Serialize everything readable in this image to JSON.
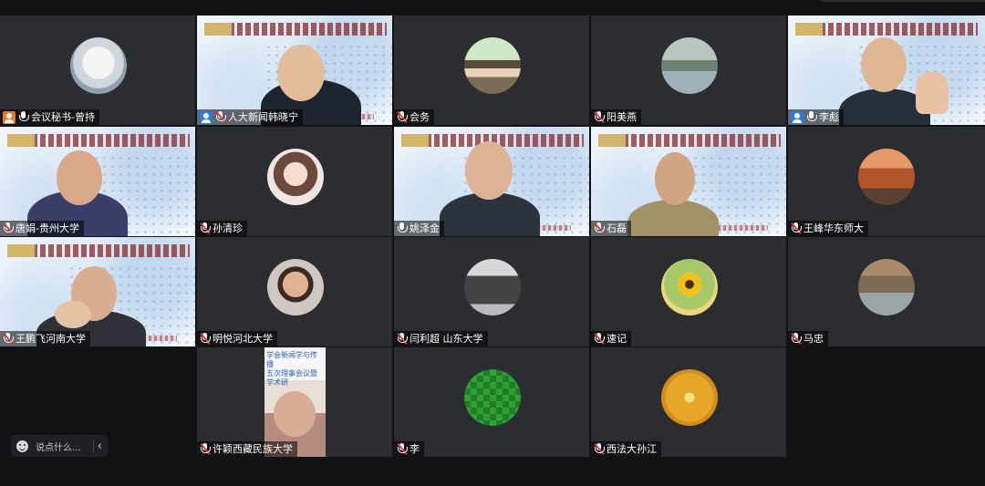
{
  "colors": {
    "background": "#111214",
    "tile": "#2b2d31",
    "active_speaker": "#29c04f",
    "host_badge": "#e8772a",
    "cohost_badge": "#2d7be0",
    "muted": "#e23a3a"
  },
  "participants": [
    {
      "name": "会议秘书-曾持",
      "badge": "host",
      "mic": "on",
      "view": "avatar",
      "avatar": "polar-bear-avatar"
    },
    {
      "name": "人大新闻韩晓宁",
      "badge": "cohost",
      "mic": "muted",
      "view": "video"
    },
    {
      "name": "会务",
      "badge": "",
      "mic": "muted",
      "view": "avatar",
      "avatar": "anime-avatar"
    },
    {
      "name": "阳美燕",
      "badge": "",
      "mic": "muted",
      "view": "avatar",
      "avatar": "lake-painting-avatar"
    },
    {
      "name": "李彪",
      "badge": "cohost",
      "mic": "on-green",
      "view": "video",
      "active": true
    },
    {
      "name": "唐娟-贵州大学",
      "badge": "",
      "mic": "muted",
      "view": "video"
    },
    {
      "name": "孙清珍",
      "badge": "",
      "mic": "muted",
      "view": "avatar",
      "avatar": "girl-portrait-avatar"
    },
    {
      "name": "姚泽金",
      "badge": "",
      "mic": "on",
      "view": "video"
    },
    {
      "name": "石磊",
      "badge": "",
      "mic": "muted",
      "view": "video"
    },
    {
      "name": "王峰华东师大",
      "badge": "",
      "mic": "muted",
      "view": "avatar",
      "avatar": "building-avatar"
    },
    {
      "name": "王鹏飞河南大学",
      "badge": "",
      "mic": "muted",
      "view": "video"
    },
    {
      "name": "明悦河北大学",
      "badge": "",
      "mic": "muted",
      "view": "avatar",
      "avatar": "smiling-man-avatar"
    },
    {
      "name": "闫利超 山东大学",
      "badge": "",
      "mic": "muted",
      "view": "avatar",
      "avatar": "suit-man-avatar"
    },
    {
      "name": "速记",
      "badge": "",
      "mic": "muted",
      "view": "avatar",
      "avatar": "sunflower-avatar"
    },
    {
      "name": "马忠",
      "badge": "",
      "mic": "muted",
      "view": "avatar",
      "avatar": "park-avatar"
    },
    {
      "name": "许颖西藏民族大学",
      "badge": "",
      "mic": "muted",
      "view": "video-portrait"
    },
    {
      "name": "李",
      "badge": "",
      "mic": "muted",
      "view": "avatar",
      "avatar": "green-diamond-avatar"
    },
    {
      "name": "西法大孙江",
      "badge": "",
      "mic": "muted",
      "view": "avatar",
      "avatar": "gold-medallion-avatar"
    }
  ],
  "portrait_slide_text": "学会新闻学与传播\n五次理事会议暨学术研",
  "chat": {
    "placeholder": "说点什么...",
    "collapse_icon": "chevron-left-icon"
  }
}
